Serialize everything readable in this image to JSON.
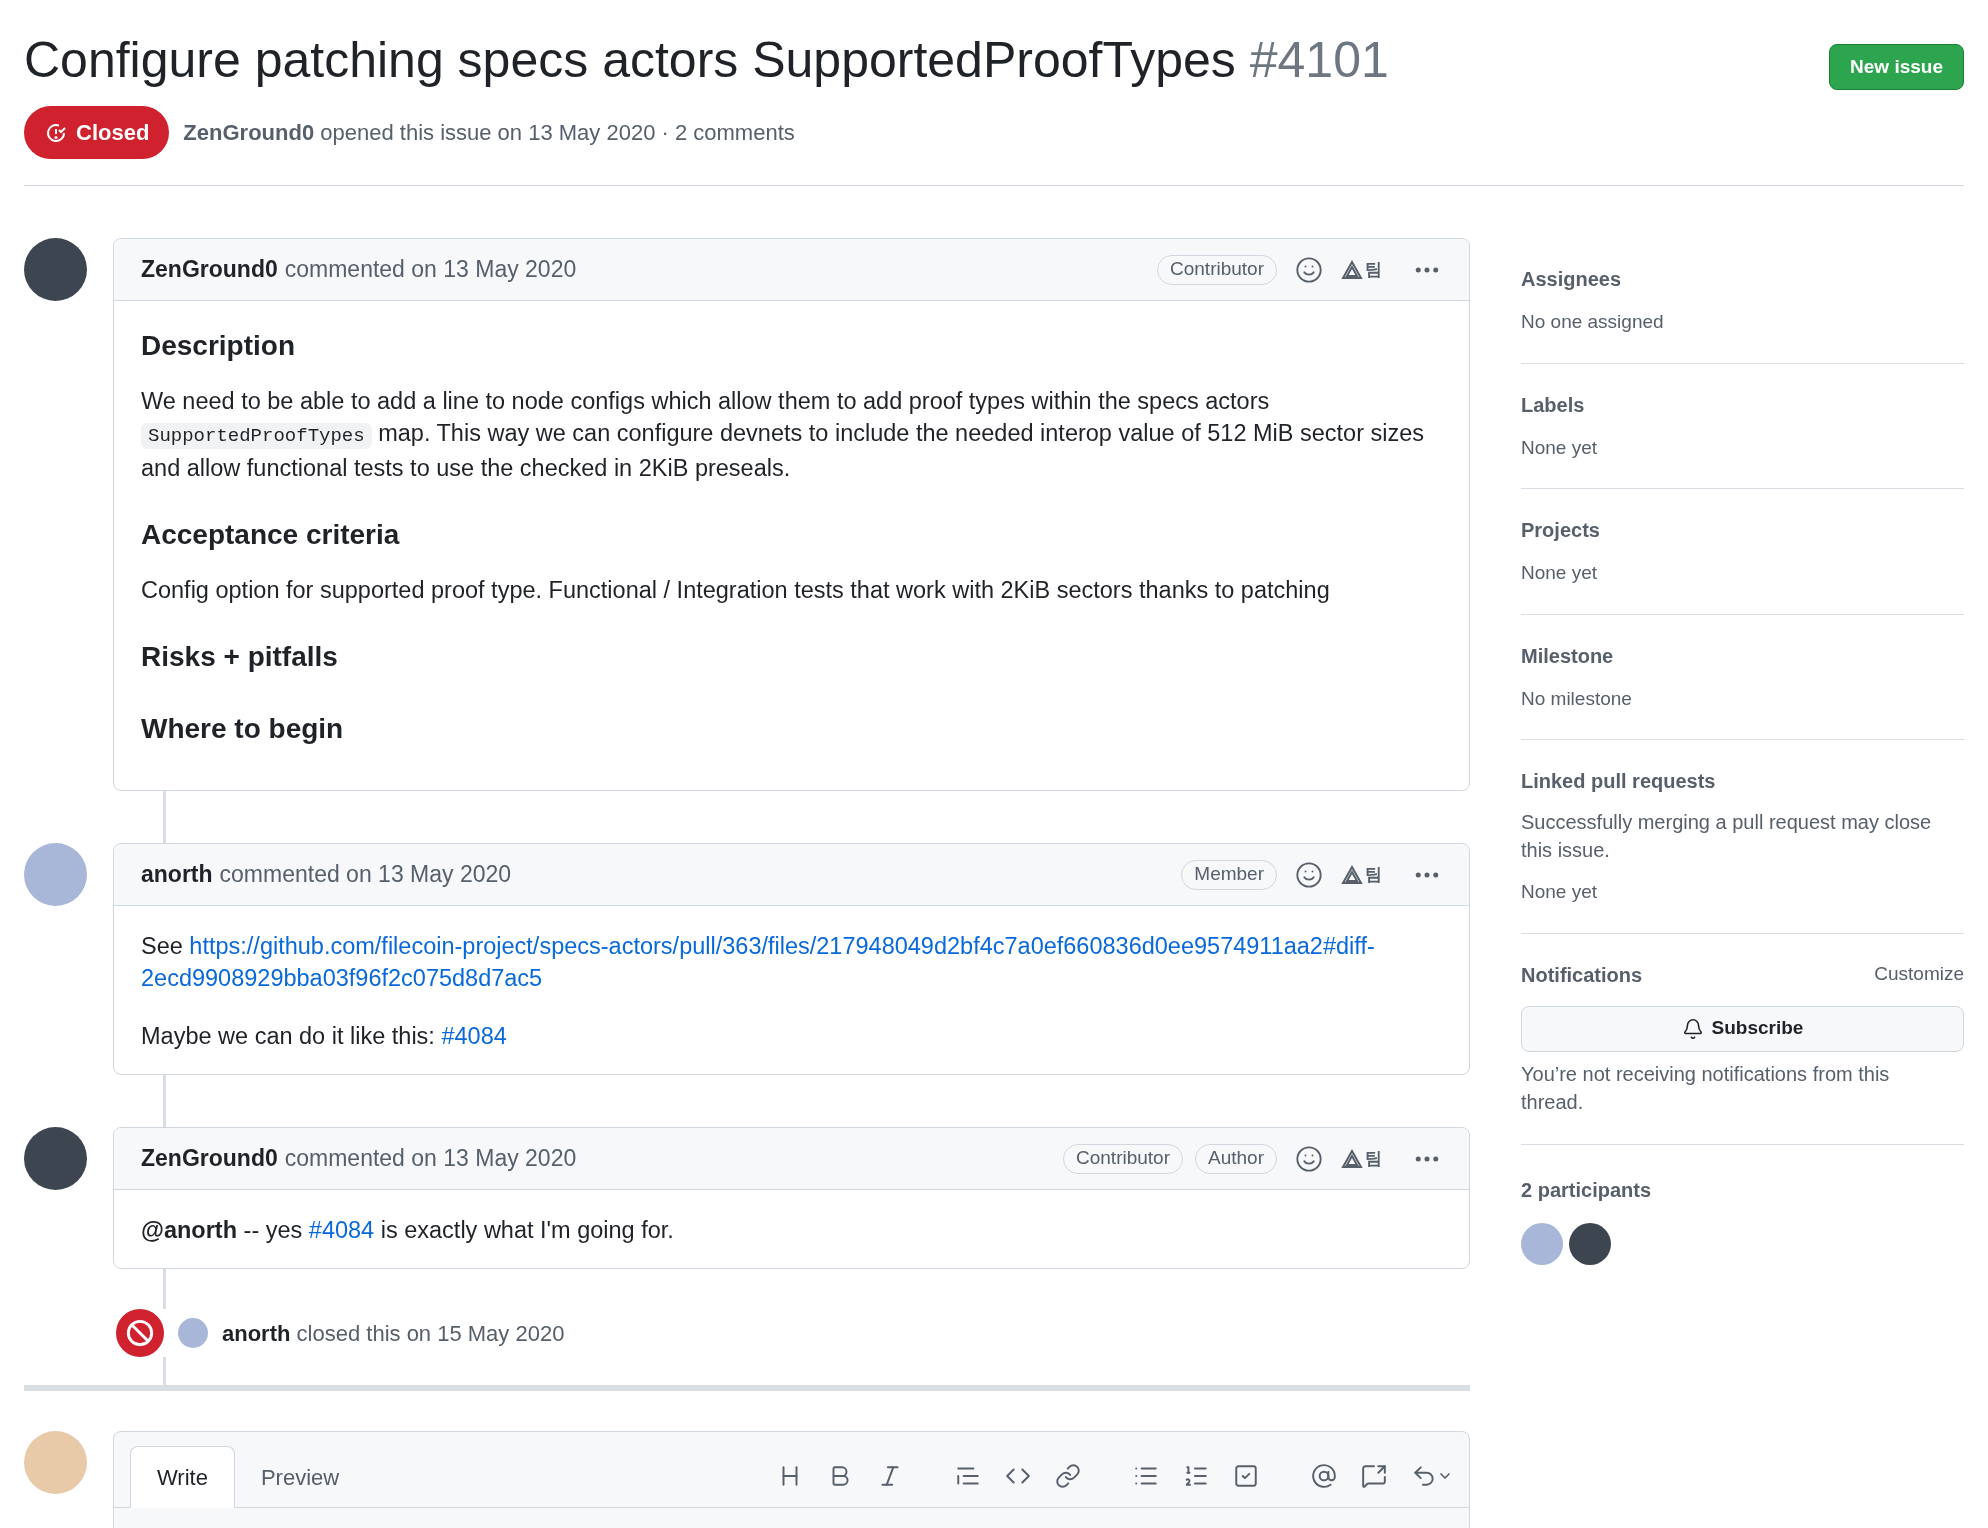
{
  "issue": {
    "title": "Configure patching specs actors SupportedProofTypes",
    "number": "#4101",
    "new_issue_button": "New issue",
    "state": {
      "label": "Closed",
      "kind": "closed"
    },
    "author": "ZenGround0",
    "opened_text": "opened this issue on 13 May 2020 · 2 comments"
  },
  "comments": [
    {
      "author": "ZenGround0",
      "meta": "commented on 13 May 2020",
      "badges": [
        "Contributor"
      ],
      "extension_mark": "팀",
      "body": [
        {
          "kind": "heading",
          "text": "Description"
        },
        {
          "kind": "paragraph",
          "parts": [
            {
              "kind": "text",
              "text": "We need to be able to add a line to node configs which allow them to add proof types within the specs actors "
            },
            {
              "kind": "code",
              "text": "SupportedProofTypes"
            },
            {
              "kind": "text",
              "text": " map. This way we can configure devnets to include the needed interop value of 512 MiB sector sizes and allow functional tests to use the checked in 2KiB preseals."
            }
          ]
        },
        {
          "kind": "heading",
          "text": "Acceptance criteria"
        },
        {
          "kind": "paragraph",
          "parts": [
            {
              "kind": "text",
              "text": "Config option for supported proof type. Functional / Integration tests that work with 2KiB sectors thanks to patching"
            }
          ]
        },
        {
          "kind": "heading",
          "text": "Risks + pitfalls"
        },
        {
          "kind": "heading",
          "text": "Where to begin"
        }
      ]
    },
    {
      "author": "anorth",
      "meta": "commented on 13 May 2020",
      "badges": [
        "Member"
      ],
      "extension_mark": "팀",
      "body": [
        {
          "kind": "paragraph",
          "parts": [
            {
              "kind": "text",
              "text": "See "
            },
            {
              "kind": "link",
              "text": "https://github.com/filecoin-project/specs-actors/pull/363/files/217948049d2bf4c7a0ef660836d0ee9574911aa2#diff-"
            },
            {
              "kind": "link",
              "text": "2ecd9908929bba03f96f2c075d8d7ac5"
            }
          ]
        },
        {
          "kind": "paragraph",
          "parts": [
            {
              "kind": "text",
              "text": "Maybe we can do it like this: "
            },
            {
              "kind": "link",
              "text": "#4084"
            }
          ]
        }
      ]
    },
    {
      "author": "ZenGround0",
      "meta": "commented on 13 May 2020",
      "badges": [
        "Contributor",
        "Author"
      ],
      "extension_mark": "팀",
      "body": [
        {
          "kind": "paragraph",
          "parts": [
            {
              "kind": "bold",
              "text": "@anorth"
            },
            {
              "kind": "text",
              "text": " -- yes "
            },
            {
              "kind": "link",
              "text": "#4084"
            },
            {
              "kind": "text",
              "text": " is exactly what I'm going for."
            }
          ]
        }
      ]
    }
  ],
  "close_event": {
    "actor": "anorth",
    "text": "closed this on 15 May 2020"
  },
  "editor": {
    "tabs": [
      {
        "label": "Write",
        "selected": true
      },
      {
        "label": "Preview",
        "selected": false
      }
    ]
  },
  "sidebar": {
    "sections": [
      {
        "kind": "plain",
        "title": "Assignees",
        "value": "No one assigned"
      },
      {
        "kind": "plain",
        "title": "Labels",
        "value": "None yet"
      },
      {
        "kind": "plain",
        "title": "Projects",
        "value": "None yet"
      },
      {
        "kind": "plain",
        "title": "Milestone",
        "value": "No milestone"
      },
      {
        "kind": "linked",
        "title": "Linked pull requests",
        "note": "Successfully merging a pull request may close this issue.",
        "value": "None yet"
      },
      {
        "kind": "notifications",
        "title": "Notifications",
        "action": "Customize",
        "button": "Subscribe",
        "note": "You’re not receiving notifications from this thread."
      },
      {
        "kind": "participants",
        "title": "2 participants"
      }
    ]
  }
}
